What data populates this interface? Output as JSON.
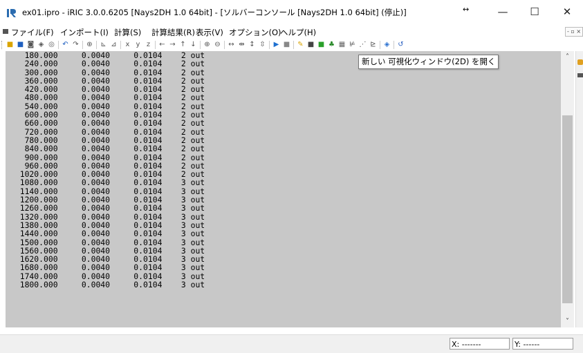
{
  "window": {
    "title": "ex01.ipro - iRIC 3.0.0.6205 [Nays2DH 1.0 64bit] - [ソルバーコンソール [Nays2DH 1.0 64bit] (停止)]",
    "resize_glyph": "↔",
    "minimize": "—",
    "maximize": "☐",
    "close": "✕"
  },
  "menu": {
    "items": [
      {
        "label": "ファイル(F)"
      },
      {
        "label": "インポート(I)"
      },
      {
        "label": "計算(S)"
      },
      {
        "label": "計算結果(R)"
      },
      {
        "label": "表示(V)"
      },
      {
        "label": "オプション(O)"
      },
      {
        "label": "ヘルプ(H)"
      }
    ],
    "mdi_controls": "- ▫ ×"
  },
  "toolbar": {
    "tooltip": "新しい 可視化ウィンドウ(2D) を開く"
  },
  "console": {
    "lines": [
      "   180.000     0.0040     0.0104    2 out",
      "   240.000     0.0040     0.0104    2 out",
      "   300.000     0.0040     0.0104    2 out",
      "   360.000     0.0040     0.0104    2 out",
      "   420.000     0.0040     0.0104    2 out",
      "   480.000     0.0040     0.0104    2 out",
      "   540.000     0.0040     0.0104    2 out",
      "   600.000     0.0040     0.0104    2 out",
      "   660.000     0.0040     0.0104    2 out",
      "   720.000     0.0040     0.0104    2 out",
      "   780.000     0.0040     0.0104    2 out",
      "   840.000     0.0040     0.0104    2 out",
      "   900.000     0.0040     0.0104    2 out",
      "   960.000     0.0040     0.0104    2 out",
      "  1020.000     0.0040     0.0104    2 out",
      "  1080.000     0.0040     0.0104    3 out",
      "  1140.000     0.0040     0.0104    3 out",
      "  1200.000     0.0040     0.0104    3 out",
      "  1260.000     0.0040     0.0104    3 out",
      "  1320.000     0.0040     0.0104    3 out",
      "  1380.000     0.0040     0.0104    3 out",
      "  1440.000     0.0040     0.0104    3 out",
      "  1500.000     0.0040     0.0104    3 out",
      "  1560.000     0.0040     0.0104    3 out",
      "  1620.000     0.0040     0.0104    3 out",
      "  1680.000     0.0040     0.0104    3 out",
      "  1740.000     0.0040     0.0104    3 out",
      "  1800.000     0.0040     0.0104    3 out"
    ]
  },
  "scrollbar": {
    "up": "˄",
    "down": "˅"
  },
  "status": {
    "x": "X: -------",
    "y": "Y: ------"
  },
  "colors": {
    "console_bg": "#c8c8c8",
    "app_icon": "#2b6cb0"
  }
}
